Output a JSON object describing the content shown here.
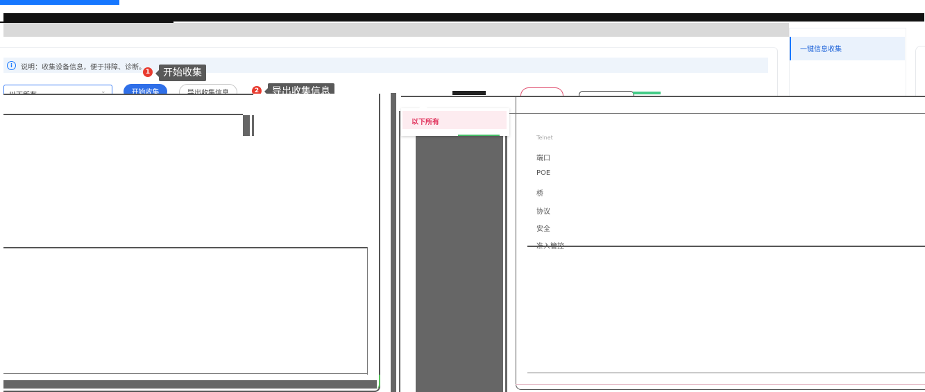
{
  "info": {
    "icon": "info-circle-icon",
    "description": "说明：收集设备信息，便于排障、诊断。"
  },
  "steps": [
    {
      "number": "1",
      "tooltip": "开始收集"
    },
    {
      "number": "2",
      "tooltip": "导出收集信息"
    }
  ],
  "toolbar": {
    "select_value": "以下所有",
    "start_label": "开始收集",
    "export_label": "导出收集信息"
  },
  "nav": {
    "active_item": "一键信息收集"
  },
  "dropdown": {
    "selected": "以下所有"
  },
  "menu": {
    "items": [
      "Telnet",
      "端口",
      "POE",
      "桥",
      "协议",
      "安全",
      "准入管控"
    ]
  },
  "colors": {
    "accent": "#1677ff",
    "badge": "#e83b2f",
    "selected_pink": "#e0305a"
  }
}
